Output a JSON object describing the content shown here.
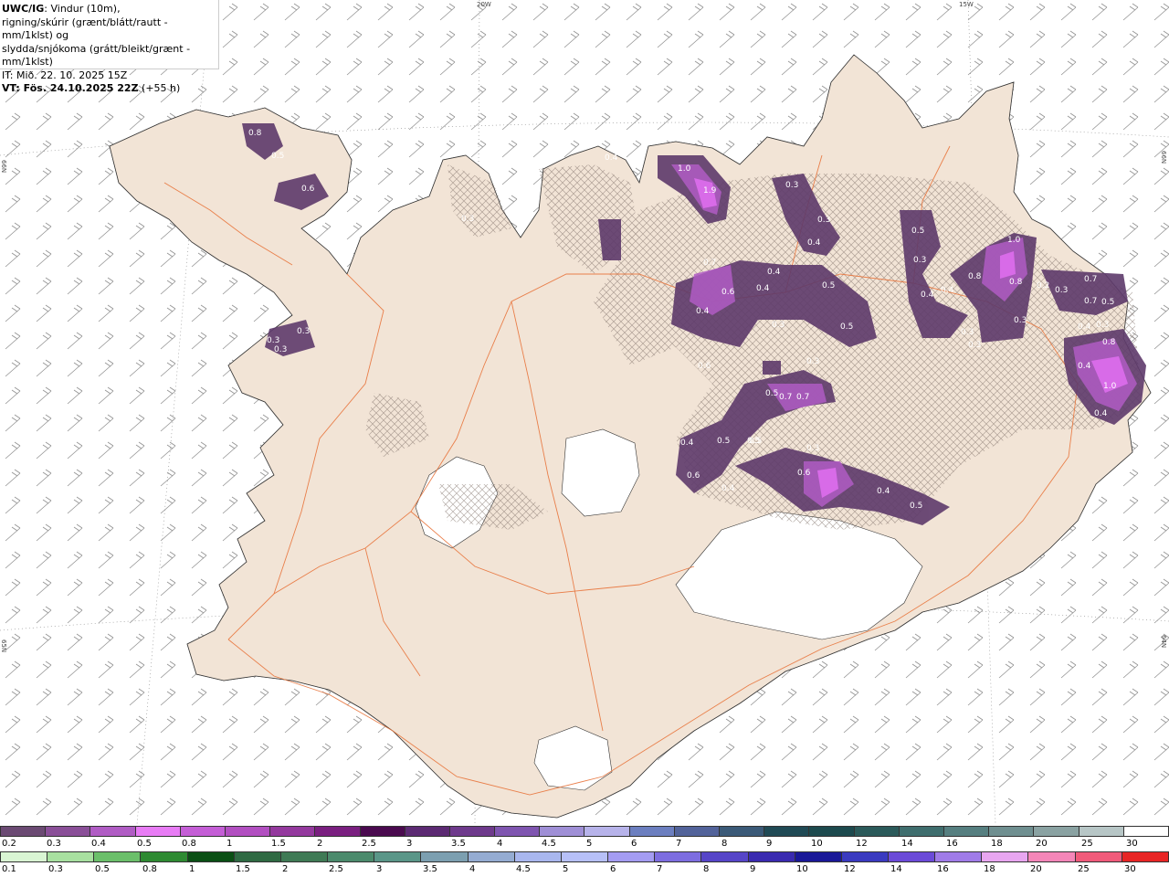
{
  "header": {
    "title": "UWC/IG",
    "line1_rest": ": Vindur (10m),",
    "line2": "rigning/skúrir (grænt/blátt/rautt - mm/1klst) og",
    "line3": "slydda/snjókoma (grátt/bleikt/grænt - mm/1klst)",
    "line4": "IT: Mið. 22. 10. 2025 15Z",
    "line5": "VT: Fös. 24.10.2025 22Z",
    "line5_rest": " (+55 h)"
  },
  "map_labels": {
    "lat_66_left": "66N",
    "lat_65_left": "65N",
    "lat_66_right": "66N",
    "lat_64_right": "64N",
    "lon_20w": "20W",
    "lon_15w": "15W"
  },
  "precip_values": [
    "0.8",
    "0.5",
    "0.6",
    "0.3",
    "0.3",
    "0.3",
    "0.4",
    "0.3",
    "1.0",
    "1.9",
    "0.4",
    "0.3",
    "0.3",
    "0.4",
    "0.5",
    "0.4",
    "0.5",
    "0.3",
    "0.5",
    "0.4",
    "0.7",
    "0.6",
    "0.4",
    "0.6",
    "0.5",
    "0.5",
    "0.3",
    "0.3",
    "0.4",
    "0.3",
    "0.8",
    "1.0",
    "0.8",
    "0.2",
    "0.3",
    "0.7",
    "0.7",
    "0.5",
    "0.4",
    "0.3",
    "0.8",
    "1.0",
    "0.4",
    "0.3",
    "0.4",
    "0.7",
    "0.7",
    "0.3",
    "0.4",
    "0.5",
    "0.5",
    "0.6",
    "0.4",
    "0.6",
    "0.3",
    "0.4",
    "0.5"
  ],
  "colors": {
    "land": "#f2e4d6",
    "sea": "#ffffff",
    "glacier": "#ffffff",
    "road": "#e8743b",
    "precip_low": "#5e3a6b",
    "precip_mid": "#9b4fb5",
    "precip_high": "#e06ef0"
  },
  "snow_scale": {
    "labels": [
      "0.2",
      "0.3",
      "0.4",
      "0.5",
      "0.8",
      "1",
      "1.5",
      "2",
      "2.5",
      "3",
      "3.5",
      "4",
      "4.5",
      "5",
      "6",
      "7",
      "8",
      "9",
      "10",
      "12",
      "14",
      "16",
      "18",
      "20",
      "25",
      "30"
    ],
    "colors": [
      "#6b4a73",
      "#8a4f98",
      "#b05cc4",
      "#e87cf5",
      "#c45ed6",
      "#b24fc1",
      "#94399e",
      "#7a1f80",
      "#4a0a4f",
      "#5c2a73",
      "#6e3a8c",
      "#7f55b0",
      "#9f8fd6",
      "#b7b3ea",
      "#6c7fc0",
      "#52639a",
      "#3b5a78",
      "#204a55",
      "#1d4a4e",
      "#2b5a5a",
      "#3f6e6e",
      "#567f80",
      "#6f8f90",
      "#8aa2a2",
      "#b7c6c6",
      "#ffffff"
    ]
  },
  "rain_scale": {
    "labels": [
      "0.1",
      "0.3",
      "0.5",
      "0.8",
      "1",
      "1.5",
      "2",
      "2.5",
      "3",
      "3.5",
      "4",
      "4.5",
      "5",
      "6",
      "7",
      "8",
      "9",
      "10",
      "12",
      "14",
      "16",
      "18",
      "20",
      "25",
      "30"
    ],
    "colors": [
      "#d9f5d3",
      "#a8e0a0",
      "#6bbf6a",
      "#2e8a32",
      "#0a4f14",
      "#2f6a43",
      "#3f7a55",
      "#4b8a6c",
      "#5a9688",
      "#7c9fb0",
      "#95acd2",
      "#a9b7ee",
      "#b7c0f8",
      "#a49cf2",
      "#7d6de0",
      "#5645c8",
      "#3a2ab0",
      "#1a1898",
      "#3a3ac0",
      "#6b4ad8",
      "#a07be8",
      "#e8a6f0",
      "#f486b8",
      "#f05a7a",
      "#e82525"
    ]
  }
}
